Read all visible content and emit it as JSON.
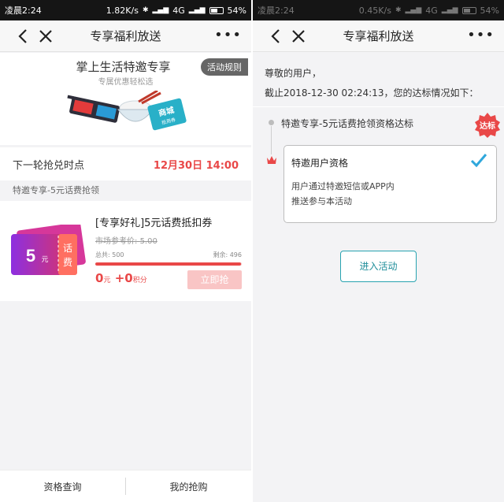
{
  "left_screen": {
    "status": {
      "time": "凌晨2:24",
      "speed": "1.82K/s",
      "network": "4G",
      "battery": "54%"
    },
    "nav": {
      "title": "专享福利放送",
      "more": "•••"
    },
    "hero": {
      "title": "掌上生活特邀专享",
      "subtitle": "专属优惠轻松选",
      "rules_button": "活动规则",
      "art_tag_line1": "商城",
      "art_tag_line2": "抵用券"
    },
    "next_round": {
      "label": "下一轮抢兑时点",
      "time": "12月30日 14:00"
    },
    "section_title": "特邀专享-5元话费抢领",
    "product": {
      "coupon_value": "5",
      "coupon_unit": "元",
      "coupon_type_1": "话",
      "coupon_type_2": "费",
      "name": "[专享好礼]5元话费抵扣券",
      "market_price_label": "市场参考价: ",
      "market_price": "5.00",
      "total_label": "总共: 500",
      "remaining_label": "剩余: 496",
      "remaining_fraction": 0.992,
      "price_amount": "0",
      "price_unit": "元",
      "plus": "+",
      "points_amount": "0",
      "points_unit": "积分",
      "grab_button": "立即抢"
    },
    "bottom_tabs": [
      "资格查询",
      "我的抢购"
    ]
  },
  "right_screen": {
    "status": {
      "time": "凌晨2:24",
      "speed": "0.45K/s",
      "network": "4G",
      "battery": "54%"
    },
    "nav": {
      "title": "专享福利放送",
      "more": "•••"
    },
    "greeting": "尊敬的用户，",
    "deadline": "截止2018-12-30 02:24:13，您的达标情况如下：",
    "milestone": "特邀专享-5元话费抢领资格达标",
    "badge": "达标",
    "card": {
      "title": "特邀用户资格",
      "desc_line1": "用户通过特邀短信或APP内",
      "desc_line2": "推送参与本活动"
    },
    "enter_button": "进入活动"
  },
  "colors": {
    "accent_red": "#e94848",
    "accent_teal": "#28a3b0",
    "coupon_purple": "#b026c7",
    "coupon_pink": "#e0355f"
  }
}
